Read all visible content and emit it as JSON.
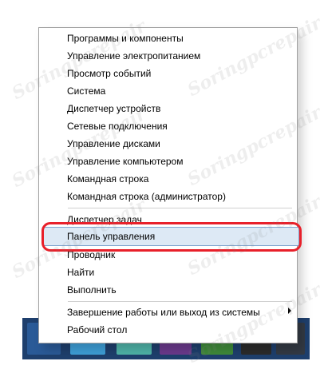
{
  "watermark": "Soringpcrepair",
  "menu": {
    "items": [
      "Программы и компоненты",
      "Управление электропитанием",
      "Просмотр событий",
      "Система",
      "Диспетчер устройств",
      "Сетевые подключения",
      "Управление дисками",
      "Управление компьютером",
      "Командная строка",
      "Командная строка (администратор)",
      "Диспетчер задач",
      "Панель управления",
      "Проводник",
      "Найти",
      "Выполнить",
      "Завершение работы или выход из системы",
      "Рабочий стол"
    ],
    "highlighted_index": 11
  },
  "colors": {
    "highlight_fill": "#dde9f5",
    "highlight_border": "#7fa4cf",
    "annotation": "#e8202a",
    "taskbar": "#1e3f6d"
  },
  "icons": {
    "submenu": "chevron-right-icon"
  }
}
